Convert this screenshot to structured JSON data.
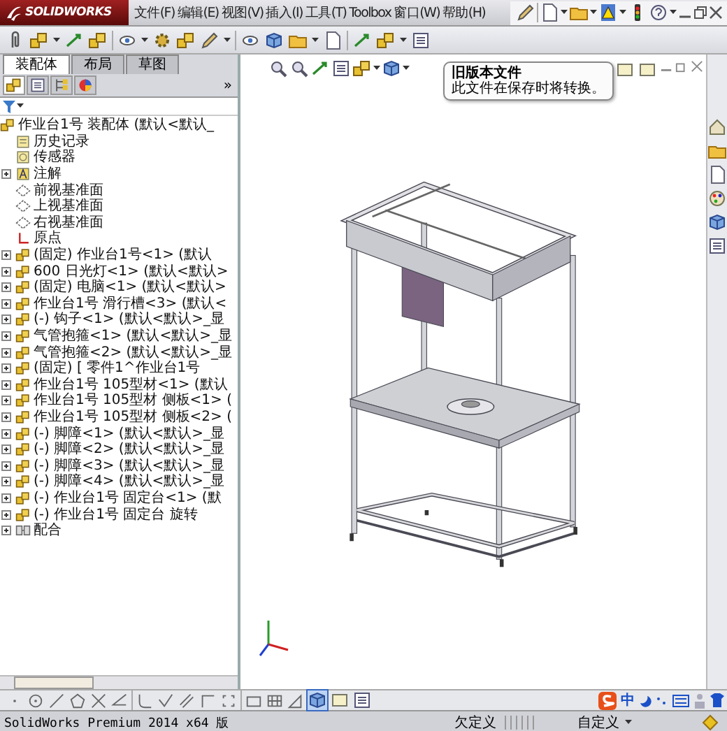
{
  "app": {
    "logo": "SOLIDWORKS"
  },
  "menu": [
    "文件(F)",
    "编辑(E)",
    "视图(V)",
    "插入(I)",
    "工具(T)",
    "Toolbox",
    "窗口(W)",
    "帮助(H)"
  ],
  "panel_tabs": [
    {
      "label": "装配体",
      "selected": true
    },
    {
      "label": "布局",
      "selected": false
    },
    {
      "label": "草图",
      "selected": false
    }
  ],
  "panel_views": [
    {
      "kind": "tree",
      "selected": true
    },
    {
      "kind": "properties",
      "selected": false
    },
    {
      "kind": "configurations",
      "selected": false
    },
    {
      "kind": "appearance",
      "selected": false
    }
  ],
  "panel_more": "»",
  "tree": [
    {
      "label": "作业台1号 装配体 (默认<默认_",
      "kind": "assembly",
      "children": [
        {
          "label": "历史记录",
          "kind": "history"
        },
        {
          "label": "传感器",
          "kind": "sensor"
        },
        {
          "label": "注解",
          "kind": "annotation",
          "expanded": false
        },
        {
          "label": "前视基准面",
          "kind": "plane"
        },
        {
          "label": "上视基准面",
          "kind": "plane"
        },
        {
          "label": "右视基准面",
          "kind": "plane"
        },
        {
          "label": "原点",
          "kind": "origin"
        },
        {
          "label": "(固定) 作业台1号<1> (默认",
          "kind": "part",
          "expanded": false
        },
        {
          "label": "600 日光灯<1> (默认<默认>",
          "kind": "part",
          "expanded": false
        },
        {
          "label": "(固定) 电脑<1> (默认<默认>",
          "kind": "part",
          "expanded": false
        },
        {
          "label": "作业台1号 滑行槽<3> (默认<",
          "kind": "part",
          "expanded": false
        },
        {
          "label": "(-) 钩子<1> (默认<默认>_显",
          "kind": "part",
          "expanded": false
        },
        {
          "label": "气管抱箍<1> (默认<默认>_显",
          "kind": "part",
          "expanded": false
        },
        {
          "label": "气管抱箍<2> (默认<默认>_显",
          "kind": "part",
          "expanded": false
        },
        {
          "label": "(固定) [ 零件1^作业台1号",
          "kind": "part",
          "expanded": false
        },
        {
          "label": "作业台1号 105型材<1> (默认",
          "kind": "part",
          "expanded": false
        },
        {
          "label": "作业台1号 105型材 侧板<1> (",
          "kind": "part",
          "expanded": false
        },
        {
          "label": "作业台1号 105型材 侧板<2> (",
          "kind": "part",
          "expanded": false
        },
        {
          "label": "(-) 脚障<1> (默认<默认>_显",
          "kind": "part",
          "expanded": false
        },
        {
          "label": "(-) 脚障<2> (默认<默认>_显",
          "kind": "part",
          "expanded": false
        },
        {
          "label": "(-) 脚障<3> (默认<默认>_显",
          "kind": "part",
          "expanded": false
        },
        {
          "label": "(-) 脚障<4> (默认<默认>_显",
          "kind": "part",
          "expanded": false
        },
        {
          "label": "(-) 作业台1号 固定台<1> (默",
          "kind": "part",
          "expanded": false
        },
        {
          "label": "(-) 作业台1号 固定台 旋转",
          "kind": "part",
          "expanded": false
        },
        {
          "label": "配合",
          "kind": "mates",
          "expanded": false
        }
      ]
    }
  ],
  "tooltip": {
    "title": "旧版本文件",
    "text": "此文件在保存时将转换。"
  },
  "ime": {
    "label": "中"
  },
  "status_bar": {
    "product": "SolidWorks Premium 2014 x64 版",
    "state": "欠定义",
    "units": "自定义"
  }
}
